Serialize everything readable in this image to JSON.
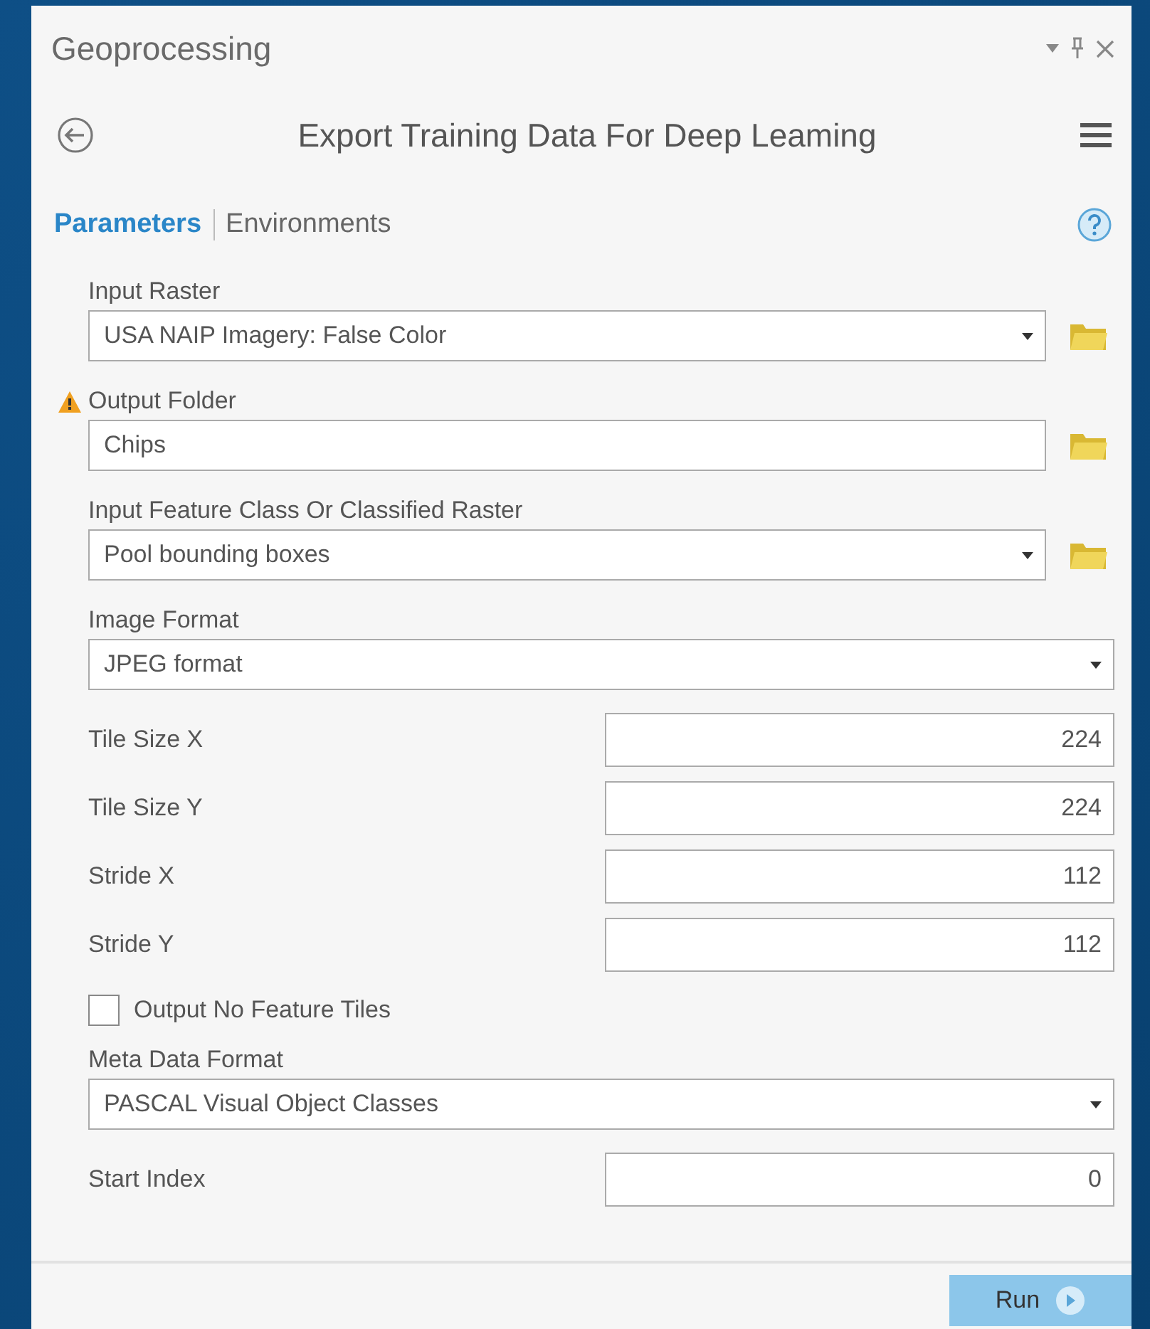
{
  "pane": {
    "title": "Geoprocessing"
  },
  "tool": {
    "title": "Export Training Data For Deep Leaming"
  },
  "tabs": [
    {
      "label": "Parameters",
      "selected": true
    },
    {
      "label": "Environments",
      "selected": false
    }
  ],
  "parameters": [
    {
      "kind": "dropdown",
      "label": "Input Raster",
      "value": "USA NAIP Imagery: False Color",
      "browse": true,
      "warning": false
    },
    {
      "kind": "text",
      "label": "Output Folder",
      "value": "Chips",
      "browse": true,
      "warning": true
    },
    {
      "kind": "dropdown",
      "label": "Input Feature Class Or Classified Raster",
      "value": "Pool bounding boxes",
      "browse": true,
      "warning": false
    },
    {
      "kind": "dropdown",
      "label": "Image Format",
      "value": "JPEG format",
      "browse": false,
      "warning": false
    },
    {
      "kind": "number",
      "label": "Tile Size X",
      "value": "224"
    },
    {
      "kind": "number",
      "label": "Tile Size Y",
      "value": "224"
    },
    {
      "kind": "number",
      "label": "Stride X",
      "value": "112"
    },
    {
      "kind": "number",
      "label": "Stride Y",
      "value": "112"
    },
    {
      "kind": "checkbox",
      "label": "Output No Feature Tiles",
      "checked": false
    },
    {
      "kind": "dropdown",
      "label": "Meta Data Format",
      "value": "PASCAL Visual Object Classes",
      "browse": false,
      "warning": false
    },
    {
      "kind": "number",
      "label": "Start Index",
      "value": "0"
    }
  ],
  "run_button": {
    "label": "Run"
  }
}
